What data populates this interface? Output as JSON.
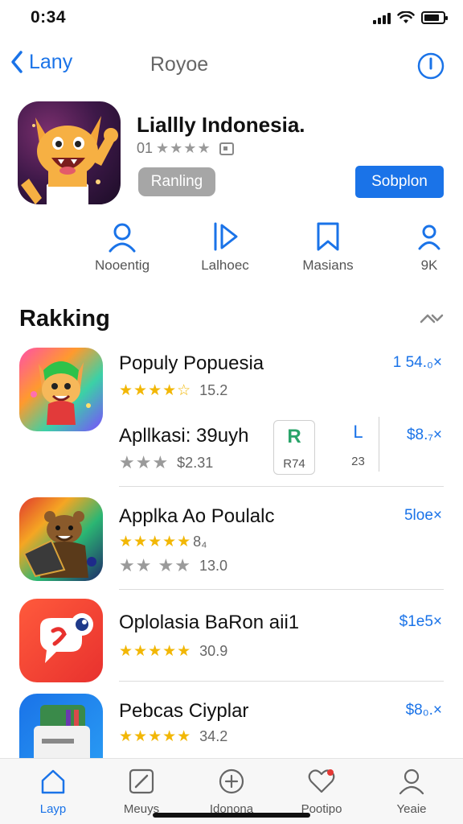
{
  "status_bar": {
    "time": "0:34"
  },
  "nav": {
    "back_label": "Lany",
    "title": "Royoe"
  },
  "app": {
    "name": "Liallly Indonesia.",
    "rating_prefix": "01",
    "rating_stars": "★★★★",
    "ranking_button": "Ranling",
    "primary_button": "Sobplon"
  },
  "meta": [
    {
      "label": "Nooentig",
      "icon": "person-icon"
    },
    {
      "label": "Lalhoec",
      "icon": "play-icon"
    },
    {
      "label": "Masians",
      "icon": "bookmark-icon"
    },
    {
      "label": "9K",
      "icon": "user-icon"
    }
  ],
  "section": {
    "title": "Rakking"
  },
  "list": [
    {
      "title": "Populy Popuesia",
      "price": "1 54.₀×",
      "stars": "★★★★☆",
      "rating": "15.2"
    },
    {
      "title": "Apllkasi: 39uyh",
      "price": "$8.₇×",
      "stars": "★★★",
      "rating": "$2.31",
      "mini_cards": [
        {
          "glyph": "R",
          "label": "R74"
        },
        {
          "glyph": "L",
          "label": "23"
        }
      ]
    },
    {
      "title": "Applka Ao Poulalc",
      "price": "5loe×",
      "stars_gold": "★★★★★",
      "stars_suffix": "8₄",
      "stars": "★★ ★★",
      "rating": "13.0"
    },
    {
      "title": "Oplolasia BaRon aii1",
      "price": "$1e5×",
      "stars": "★★★★★",
      "rating": "30.9"
    },
    {
      "title": "Pebcas Ciyplar",
      "price": "$8₀.×",
      "stars": "★★★★★",
      "rating": "34.2"
    }
  ],
  "tabs": [
    {
      "label": "Layp",
      "icon": "home-icon",
      "active": true
    },
    {
      "label": "Meuys",
      "icon": "edit-icon",
      "active": false
    },
    {
      "label": "Idonona",
      "icon": "plus-icon",
      "active": false
    },
    {
      "label": "Pootipo",
      "icon": "heart-icon",
      "active": false
    },
    {
      "label": "Yeaie",
      "icon": "person-icon",
      "active": false
    }
  ],
  "colors": {
    "accent": "#1a73e8",
    "star_gold": "#f2b705",
    "star_gray": "#9a9a9a"
  }
}
